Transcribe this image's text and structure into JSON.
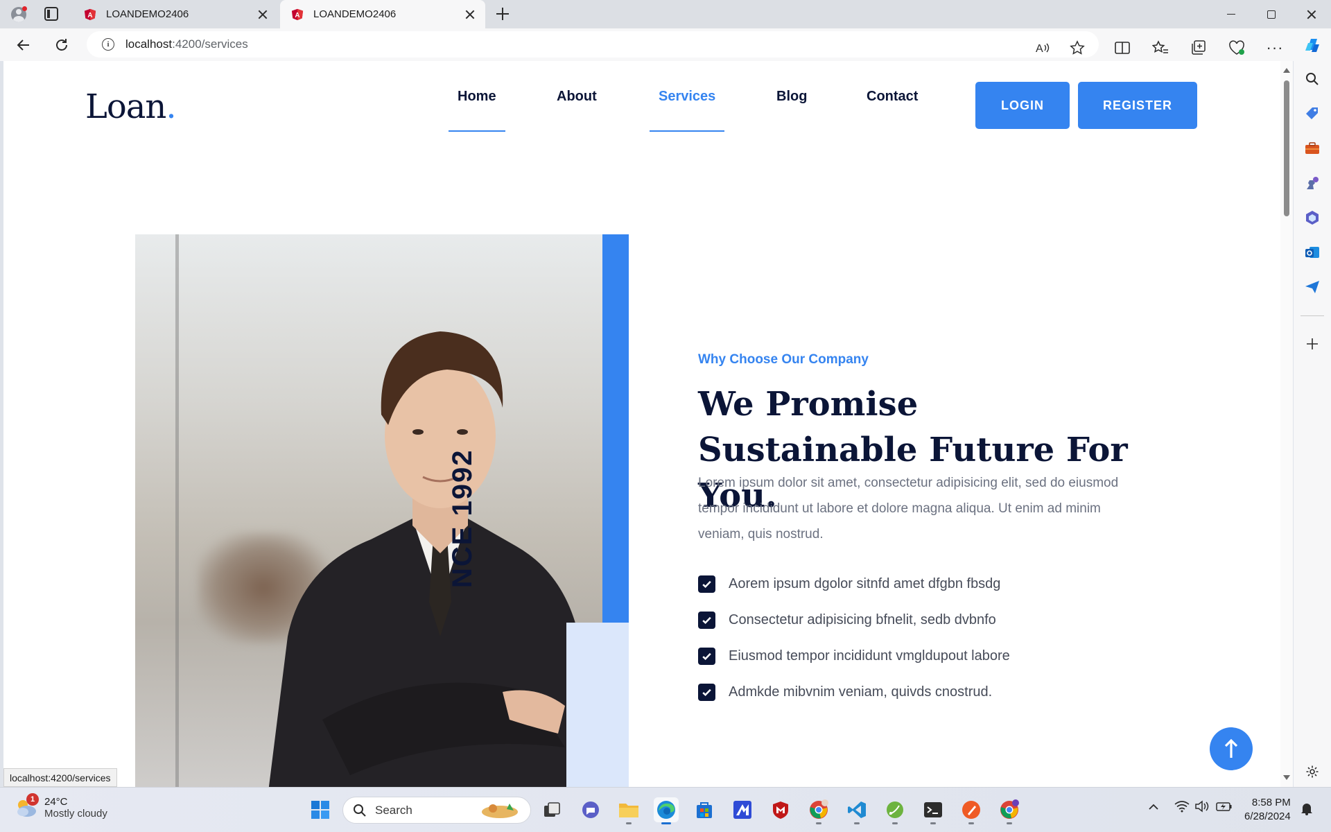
{
  "browser": {
    "tabs": [
      {
        "title": "LOANDEMO2406"
      },
      {
        "title": "LOANDEMO2406"
      }
    ],
    "url_host": "localhost",
    "url_path": ":4200/services",
    "status_url": "localhost:4200/services"
  },
  "site": {
    "logo_text": "Loan",
    "logo_dot": ".",
    "nav": {
      "home": "Home",
      "about": "About",
      "services": "Services",
      "blog": "Blog",
      "contact": "Contact"
    },
    "active_nav": "Services",
    "login_label": "LOGIN",
    "register_label": "REGISTER",
    "accent_color": "#3584f0",
    "dark_color": "#0b1537"
  },
  "hero": {
    "since_label": "NCE 1992",
    "eyebrow": "Why Choose Our Company",
    "headline": "We Promise Sustainable Future For You.",
    "paragraph": "Lorem ipsum dolor sit amet, consectetur adipisicing elit, sed do eiusmod tempor incididunt ut labore et dolore magna aliqua. Ut enim ad minim veniam, quis nostrud.",
    "checklist": [
      "Aorem ipsum dgolor sitnfd amet dfgbn fbsdg",
      "Consectetur adipisicing bfnelit, sedb dvbnfo",
      "Eiusmod tempor incididunt vmgldupout labore",
      "Admkde mibvnim veniam, quivds cnostrud."
    ]
  },
  "taskbar": {
    "weather_temp": "24°C",
    "weather_desc": "Mostly cloudy",
    "weather_badge": "1",
    "search_label": "Search",
    "time": "8:58 PM",
    "date": "6/28/2024"
  }
}
